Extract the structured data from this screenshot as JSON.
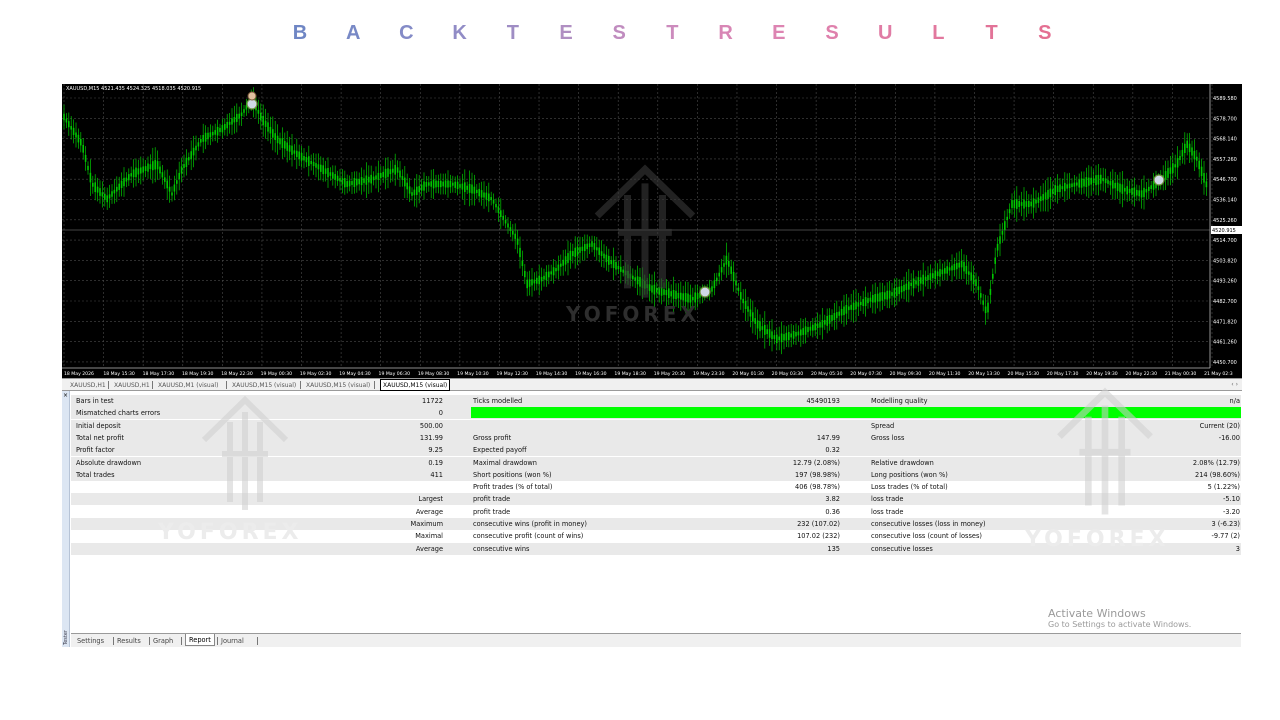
{
  "header": {
    "title_letters": [
      "B",
      "A",
      "C",
      "K",
      "T",
      "E",
      "S",
      "T",
      "R",
      "E",
      "S",
      "U",
      "L",
      "T",
      "S"
    ],
    "letter_colors": [
      "#6f86c4",
      "#7889c6",
      "#848bc7",
      "#918cc6",
      "#9f8dc4",
      "#b08fc2",
      "#c08cbf",
      "#cc8bbd",
      "#d886b5",
      "#dd84b2",
      "#df80ac",
      "#e07ca5",
      "#e2789e",
      "#e27398",
      "#e46f92"
    ]
  },
  "chart": {
    "symbol_title": "XAUUSD,M15  4521.435 4524.325 4518.035 4520.915",
    "price_labels": [
      "4589.580",
      "4578.700",
      "4568.140",
      "4557.260",
      "4546.700",
      "4536.140",
      "4525.260",
      "4514.700",
      "4503.820",
      "4493.260",
      "4482.700",
      "4471.820",
      "4461.260",
      "4450.700"
    ],
    "current_price": "4520.915",
    "time_labels": [
      "18 May 2026",
      "18 May 15:30",
      "18 May 17:30",
      "18 May 19:30",
      "18 May 22:30",
      "19 May 00:30",
      "19 May 02:30",
      "19 May 04:30",
      "19 May 06:30",
      "19 May 08:30",
      "19 May 10:30",
      "19 May 12:30",
      "19 May 14:30",
      "19 May 16:30",
      "19 May 18:30",
      "19 May 20:30",
      "19 May 23:30",
      "20 May 01:30",
      "20 May 03:30",
      "20 May 05:30",
      "20 May 07:30",
      "20 May 09:30",
      "20 May 11:30",
      "20 May 13:30",
      "20 May 15:30",
      "20 May 17:30",
      "20 May 19:30",
      "20 May 22:30",
      "21 May 00:30",
      "21 May 02:3"
    ],
    "candle_color": "#00c800",
    "background": "#000000"
  },
  "chart_tabs": [
    {
      "label": "XAUUSD,H1",
      "active": false
    },
    {
      "label": "XAUUSD,H1",
      "active": false
    },
    {
      "label": "XAUUSD,M1 (visual)",
      "active": false
    },
    {
      "label": "XAUUSD,M15 (visual)",
      "active": false
    },
    {
      "label": "XAUUSD,M15 (visual)",
      "active": false
    },
    {
      "label": "XAUUSD,M15 (visual)",
      "active": true
    }
  ],
  "tab_arrows": "‹ ›",
  "tester": {
    "close": "×",
    "side_label": "Tester"
  },
  "report": {
    "rows": [
      {
        "shade": true,
        "l1": "Bars in test",
        "v1": "11722",
        "l2": "Ticks modelled",
        "v2": "45490193",
        "l3": "Modelling quality",
        "v3": "n/a"
      },
      {
        "shade": true,
        "l1": "Mismatched charts errors",
        "v1": "0",
        "l2": "",
        "v2": "",
        "l3": "",
        "v3": ""
      },
      {
        "shade": true,
        "l1": "Initial deposit",
        "v1": "500.00",
        "l2": "",
        "v2": "",
        "l3": "Spread",
        "v3": "Current (20)"
      },
      {
        "shade": true,
        "l1": "Total net profit",
        "v1": "131.99",
        "l2": "Gross profit",
        "v2": "147.99",
        "l3": "Gross loss",
        "v3": "-16.00"
      },
      {
        "shade": true,
        "l1": "Profit factor",
        "v1": "9.25",
        "l2": "Expected payoff",
        "v2": "0.32",
        "l3": "",
        "v3": ""
      },
      {
        "shade": true,
        "l1": "Absolute drawdown",
        "v1": "0.19",
        "l2": "Maximal drawdown",
        "v2": "12.79 (2.08%)",
        "l3": "Relative drawdown",
        "v3": "2.08% (12.79)"
      },
      {
        "shade": true,
        "l1": "Total trades",
        "v1": "411",
        "l2": "Short positions (won %)",
        "v2": "197 (98.98%)",
        "l3": "Long positions (won %)",
        "v3": "214 (98.60%)"
      },
      {
        "shade": false,
        "l1": "",
        "v1": "",
        "l2": "Profit trades (% of total)",
        "v2": "406 (98.78%)",
        "l3": "Loss trades (% of total)",
        "v3": "5 (1.22%)"
      },
      {
        "shade": true,
        "l1": "",
        "v1": "Largest",
        "l2": "profit trade",
        "v2": "3.82",
        "l3": "loss trade",
        "v3": "-5.10"
      },
      {
        "shade": false,
        "l1": "",
        "v1": "Average",
        "l2": "profit trade",
        "v2": "0.36",
        "l3": "loss trade",
        "v3": "-3.20"
      },
      {
        "shade": true,
        "l1": "",
        "v1": "Maximum",
        "l2": "consecutive wins (profit in money)",
        "v2": "232 (107.02)",
        "l3": "consecutive losses (loss in money)",
        "v3": "3 (-6.23)"
      },
      {
        "shade": false,
        "l1": "",
        "v1": "Maximal",
        "l2": "consecutive profit (count of wins)",
        "v2": "107.02 (232)",
        "l3": "consecutive loss (count of losses)",
        "v3": "-9.77 (2)"
      },
      {
        "shade": true,
        "l1": "",
        "v1": "Average",
        "l2": "consecutive wins",
        "v2": "135",
        "l3": "consecutive losses",
        "v3": "3"
      }
    ],
    "modelling_quality_color": "#00ff00"
  },
  "bottom_tabs": [
    {
      "label": "Settings",
      "active": false
    },
    {
      "label": "Results",
      "active": false
    },
    {
      "label": "Graph",
      "active": false
    },
    {
      "label": "Report",
      "active": true
    },
    {
      "label": "Journal",
      "active": false
    }
  ],
  "watermark": {
    "text": "YOFOREX"
  },
  "activate_windows": {
    "title": "Activate Windows",
    "subtitle": "Go to Settings to activate Windows."
  }
}
